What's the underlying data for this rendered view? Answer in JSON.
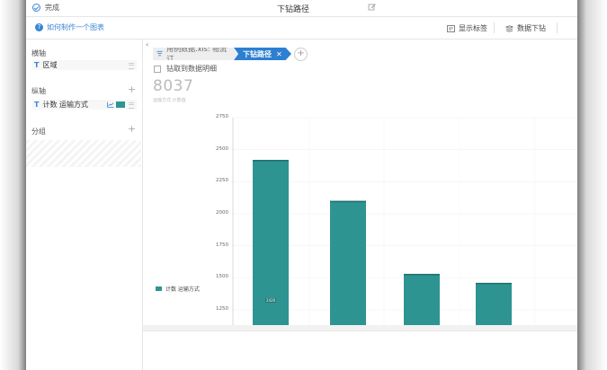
{
  "topbar": {
    "done_label": "完成",
    "title": "下钻路径"
  },
  "help": {
    "label": "如何制作一个图表"
  },
  "toolbar": {
    "show_labels": "显示标签",
    "drill_data": "数据下钻"
  },
  "sidebar": {
    "x_axis": {
      "title": "横轴",
      "field": "区域"
    },
    "y_axis": {
      "title": "纵轴",
      "field": "计数 运输方式",
      "swatch_color": "#2e9491"
    },
    "group": {
      "title": "分组"
    }
  },
  "main": {
    "crumbs": [
      {
        "label": "用例数据.xls: 物流订..."
      },
      {
        "label": "下钻路径"
      }
    ],
    "drill_label": "钻取到数据明细",
    "summary_value": "8037",
    "summary_label": "运输方式 计数值"
  },
  "chart_data": {
    "type": "bar",
    "categories": [
      "",
      "",
      "",
      ""
    ],
    "series": [
      {
        "name": "计数 运输方式",
        "values": [
          2420,
          2100,
          1530,
          1460
        ],
        "color": "#2e9491"
      }
    ],
    "ylim": [
      1130,
      2750
    ],
    "yticks": [
      1250,
      1500,
      1750,
      2000,
      2250,
      2500,
      2750
    ],
    "first_bar_label": "2420",
    "legend": "计数 运输方式"
  }
}
